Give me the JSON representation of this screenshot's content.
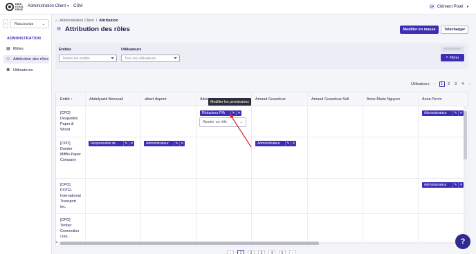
{
  "topbar": {
    "logo_text": "DATA LEGAL DRIVE",
    "nav_admin": "Administration Client",
    "nav_csm": "CSM",
    "user_initials": "CP",
    "user_name": "Clément Potel"
  },
  "sidebar": {
    "collapse": "‹",
    "shortcut": "Raccourcis",
    "section": "ADMINISTRATION",
    "items": [
      {
        "label": "Rôles",
        "icon": "roles-icon"
      },
      {
        "label": "Attribution des rôles",
        "icon": "assign-icon"
      },
      {
        "label": "Utilisateurs",
        "icon": "users-icon"
      }
    ]
  },
  "breadcrumb": {
    "root": "Administration Client",
    "sep": "/",
    "current": "Attribution"
  },
  "page": {
    "title": "Attribution des rôles",
    "bulk_button": "Modifier en masse",
    "download_button": "Télécharger"
  },
  "filters": {
    "entities_label": "Entités",
    "entities_placeholder": "Toutes les entités",
    "users_label": "Utilisateurs",
    "users_placeholder": "Tous les utilisateurs",
    "reset": "Réinitialiser",
    "filter": "Filtrer"
  },
  "pager_top": {
    "label": "Utilisateurs",
    "prev": "‹",
    "pages": [
      "1",
      "2",
      "3",
      "4"
    ],
    "next": "›"
  },
  "table": {
    "entity_header": "Entité",
    "columns": [
      "Abdelyazid Benouali",
      "albert dupont",
      "Alexis",
      "Arnaud Goasdoue",
      "Arnaud Goasdoue Sell",
      "Anne-Marie Nguyen",
      "Anna Perrin"
    ],
    "rows": [
      {
        "entity": "[CPO] Desjardins Paper & Wood"
      },
      {
        "entity": "[CPO] Dunder Mifflin Paper Company"
      },
      {
        "entity": "[CPO] POTEL International Transport inc."
      },
      {
        "entity": "[CPO] Timber Connection corp."
      }
    ],
    "chips": {
      "redacteur": "Rédacteur PIA",
      "admin": "Administrateur",
      "responsable": "Responsable dr..."
    },
    "edit_glyph": "✎",
    "remove_glyph": "✕",
    "add_role": "Ajouter un rôle",
    "tooltip": "Modifier les permissions"
  },
  "pager_bottom": [
    "‹",
    "1",
    "2",
    "3",
    "4",
    "5",
    "›"
  ],
  "help": "?"
}
